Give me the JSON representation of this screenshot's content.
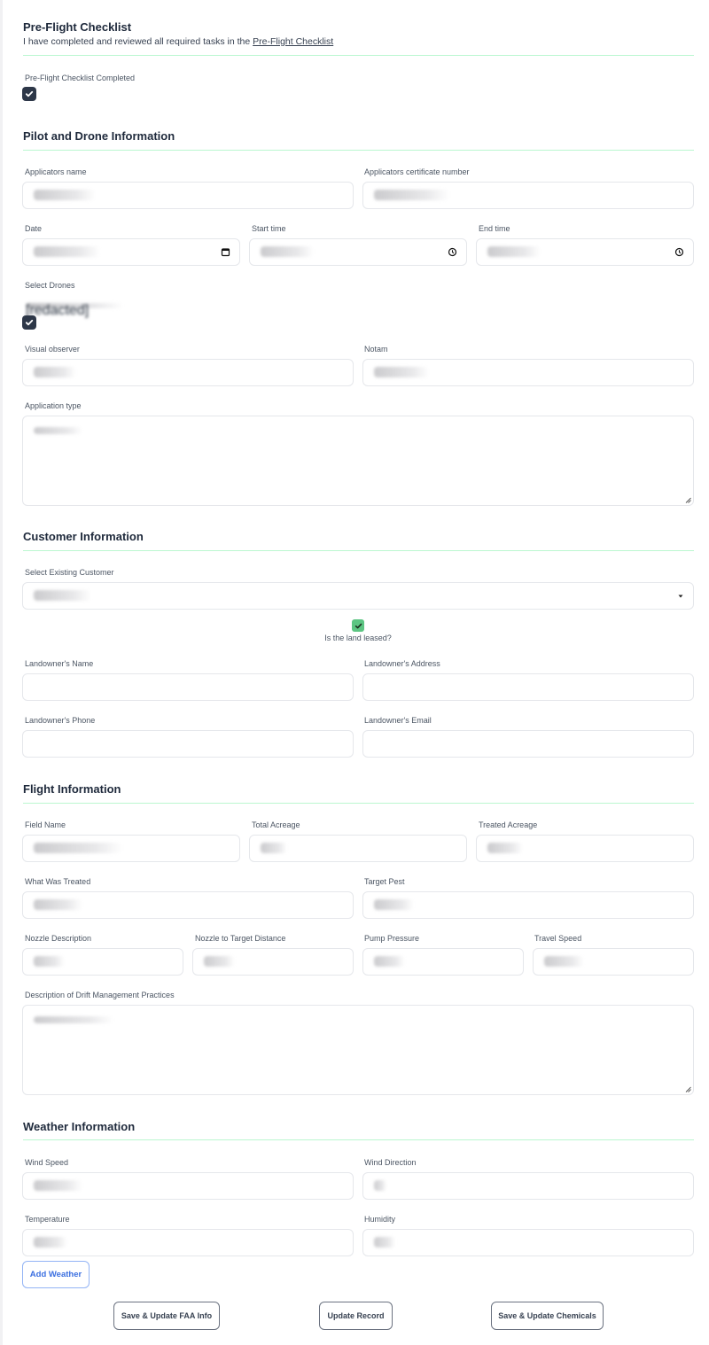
{
  "preflight": {
    "title": "Pre-Flight Checklist",
    "subtitle_text": "I have completed and reviewed all required tasks in the ",
    "subtitle_link": "Pre-Flight Checklist",
    "checkbox_label": "Pre-Flight Checklist Completed",
    "checked": true
  },
  "pilot": {
    "title": "Pilot and Drone Information",
    "applicator_name": {
      "label": "Applicators name",
      "value": "[redacted]"
    },
    "certificate_number": {
      "label": "Applicators certificate number",
      "value": "[redacted]"
    },
    "date": {
      "label": "Date",
      "value": "[redacted]",
      "icon": "calendar-icon"
    },
    "start_time": {
      "label": "Start time",
      "value": "[redacted]",
      "icon": "clock-icon"
    },
    "end_time": {
      "label": "End time",
      "value": "[redacted]",
      "icon": "clock-icon"
    },
    "drones": {
      "label": "Select Drones",
      "drone_name": "[redacted]",
      "checked": true
    },
    "visual_observer": {
      "label": "Visual observer",
      "value": "[redacted]"
    },
    "notam": {
      "label": "Notam",
      "value": "[redacted]"
    },
    "application_type": {
      "label": "Application type",
      "value": "[redacted]"
    }
  },
  "customer": {
    "title": "Customer Information",
    "select_customer": {
      "label": "Select Existing Customer",
      "value": "[redacted]"
    },
    "land_leased": {
      "label": "Is the land leased?",
      "checked": true
    },
    "landowner_name": {
      "label": "Landowner's Name",
      "value": ""
    },
    "landowner_address": {
      "label": "Landowner's Address",
      "value": ""
    },
    "landowner_phone": {
      "label": "Landowner's Phone",
      "value": ""
    },
    "landowner_email": {
      "label": "Landowner's Email",
      "value": ""
    }
  },
  "flight": {
    "title": "Flight Information",
    "field_name": {
      "label": "Field Name",
      "value": "[redacted]"
    },
    "total_acreage": {
      "label": "Total Acreage",
      "value": "[redacted]"
    },
    "treated_acreage": {
      "label": "Treated Acreage",
      "value": "[redacted]"
    },
    "what_treated": {
      "label": "What Was Treated",
      "value": "[redacted]"
    },
    "target_pest": {
      "label": "Target Pest",
      "value": "[redacted]"
    },
    "nozzle_description": {
      "label": "Nozzle Description",
      "value": "[redacted]"
    },
    "nozzle_distance": {
      "label": "Nozzle to Target Distance",
      "value": "[redacted]"
    },
    "pump_pressure": {
      "label": "Pump Pressure",
      "value": "[redacted]"
    },
    "travel_speed": {
      "label": "Travel Speed",
      "value": "[redacted]"
    },
    "drift_management": {
      "label": "Description of Drift Management Practices",
      "value": "[redacted]"
    }
  },
  "weather": {
    "title": "Weather Information",
    "wind_speed": {
      "label": "Wind Speed",
      "value": "[redacted]"
    },
    "wind_direction": {
      "label": "Wind Direction",
      "value": "[redacted]"
    },
    "temperature": {
      "label": "Temperature",
      "value": "[redacted]"
    },
    "humidity": {
      "label": "Humidity",
      "value": "[redacted]"
    },
    "add_button": "Add Weather"
  },
  "actions": {
    "save_faa": "Save & Update FAA Info",
    "update_record": "Update Record",
    "save_chemicals": "Save & Update Chemicals"
  },
  "colors": {
    "divider": "#bbf7d0",
    "checkbox_dark": "#2d3748",
    "checkbox_green": "#5cc582",
    "primary_blue": "#3b6fe0"
  }
}
